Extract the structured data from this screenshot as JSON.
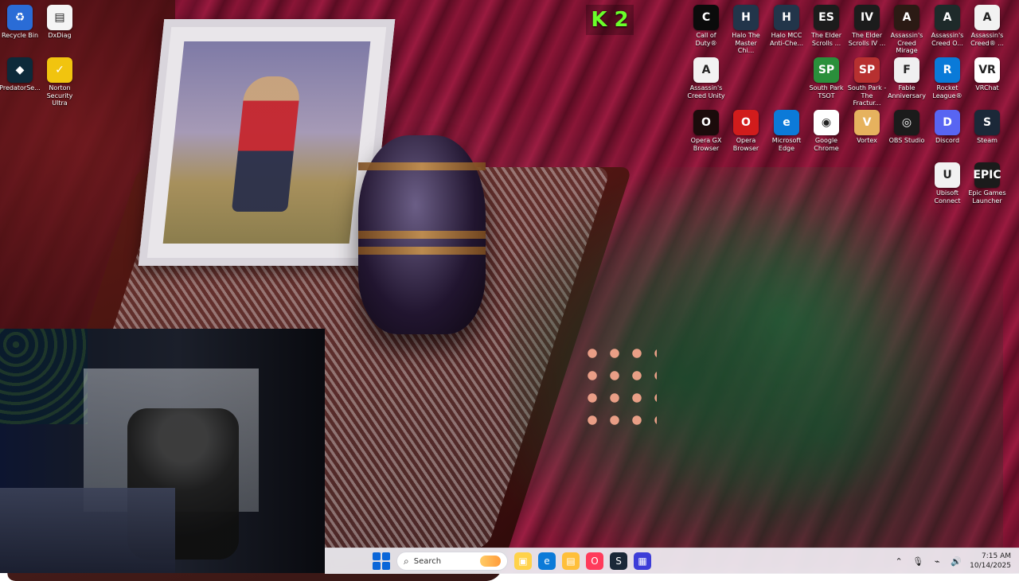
{
  "desktop": {
    "icons_left": [
      {
        "label": "Recycle Bin",
        "icon": "recycle-bin-icon",
        "bg": "#2a6cd6",
        "glyph": "♻"
      },
      {
        "label": "DxDiag",
        "icon": "document-icon",
        "bg": "#f5f5f5",
        "glyph": "▤"
      },
      {
        "label": "PredatorSe...",
        "icon": "predator-sense-icon",
        "bg": "#0d2a3a",
        "glyph": "◆"
      },
      {
        "label": "Norton\nSecurity Ultra",
        "icon": "norton-icon",
        "bg": "#f1c40f",
        "glyph": "✓"
      }
    ],
    "icons_right_rows": [
      [
        {
          "label": "Call of\nDuty®",
          "icon": "call-of-duty-icon",
          "bg": "#0b0b0b",
          "glyph": "C"
        },
        {
          "label": "Halo The\nMaster Chi...",
          "icon": "halo-mcc-icon",
          "bg": "#22354a",
          "glyph": "H"
        },
        {
          "label": "Halo MCC\nAnti-Che...",
          "icon": "halo-anticheat-icon",
          "bg": "#22354a",
          "glyph": "H"
        },
        {
          "label": "The Elder\nScrolls ...",
          "icon": "elder-scrolls-icon",
          "bg": "#1c1c1c",
          "glyph": "ES"
        },
        {
          "label": "The Elder\nScrolls IV ...",
          "icon": "elder-scrolls-iv-icon",
          "bg": "#1c1c1c",
          "glyph": "IV"
        },
        {
          "label": "Assassin's\nCreed Mirage",
          "icon": "assassins-creed-mirage-icon",
          "bg": "#2b1a14",
          "glyph": "A"
        },
        {
          "label": "Assassin's\nCreed O...",
          "icon": "assassins-creed-origins-icon",
          "bg": "#1e2a2a",
          "glyph": "A"
        },
        {
          "label": "Assassin's\nCreed® ...",
          "icon": "assassins-creed-icon",
          "bg": "#f2f2f2",
          "glyph": "A"
        }
      ],
      [
        {
          "label": "Assassin's\nCreed Unity",
          "icon": "assassins-creed-unity-icon",
          "bg": "#f2f2f2",
          "glyph": "A"
        },
        null,
        null,
        {
          "label": "South Park\nTSOT",
          "icon": "south-park-tsot-icon",
          "bg": "#2a8f3b",
          "glyph": "SP"
        },
        {
          "label": "South Park -\nThe Fractur...",
          "icon": "south-park-fractured-icon",
          "bg": "#b73030",
          "glyph": "SP"
        },
        {
          "label": "Fable\nAnniversary",
          "icon": "fable-icon",
          "bg": "#f0f0f0",
          "glyph": "F"
        },
        {
          "label": "Rocket\nLeague®",
          "icon": "rocket-league-icon",
          "bg": "#0a7ad8",
          "glyph": "R"
        },
        {
          "label": "VRChat",
          "icon": "vrchat-icon",
          "bg": "#ffffff",
          "glyph": "VR"
        }
      ],
      [
        {
          "label": "Opera GX\nBrowser",
          "icon": "opera-gx-icon",
          "bg": "#1b0b0b",
          "glyph": "O"
        },
        {
          "label": "Opera\nBrowser",
          "icon": "opera-icon",
          "bg": "#d11c1c",
          "glyph": "O"
        },
        {
          "label": "Microsoft\nEdge",
          "icon": "edge-icon",
          "bg": "#0c7ad8",
          "glyph": "e"
        },
        {
          "label": "Google\nChrome",
          "icon": "chrome-icon",
          "bg": "#ffffff",
          "glyph": "◉"
        },
        {
          "label": "Vortex",
          "icon": "vortex-icon",
          "bg": "#e6b25e",
          "glyph": "V"
        },
        {
          "label": "OBS Studio",
          "icon": "obs-icon",
          "bg": "#1b1b1b",
          "glyph": "◎"
        },
        {
          "label": "Discord",
          "icon": "discord-icon",
          "bg": "#5865f2",
          "glyph": "D"
        },
        {
          "label": "Steam",
          "icon": "steam-icon",
          "bg": "#1b2838",
          "glyph": "S"
        }
      ],
      [
        null,
        null,
        null,
        null,
        null,
        null,
        {
          "label": "Ubisoft\nConnect",
          "icon": "ubisoft-connect-icon",
          "bg": "#f2f2f2",
          "glyph": "U"
        },
        {
          "label": "Epic Games\nLauncher",
          "icon": "epic-games-icon",
          "bg": "#1b1b1b",
          "glyph": "EPIC"
        }
      ]
    ],
    "badge_text": "K 2"
  },
  "taskbar": {
    "search_placeholder": "Search",
    "apps": [
      {
        "icon": "file-explorer-icon",
        "bg": "#ffd24a",
        "glyph": "▣"
      },
      {
        "icon": "edge-icon",
        "bg": "#0c7ad8",
        "glyph": "e"
      },
      {
        "icon": "folder-icon",
        "bg": "#ffbf3a",
        "glyph": "▤"
      },
      {
        "icon": "opera-icon",
        "bg": "#ff3b5b",
        "glyph": "O"
      },
      {
        "icon": "steam-icon",
        "bg": "#1b2838",
        "glyph": "S"
      },
      {
        "icon": "app-icon",
        "bg": "#3d3dd8",
        "glyph": "▦"
      }
    ],
    "clock_time": "7:15 AM",
    "clock_date": "10/14/2025"
  }
}
